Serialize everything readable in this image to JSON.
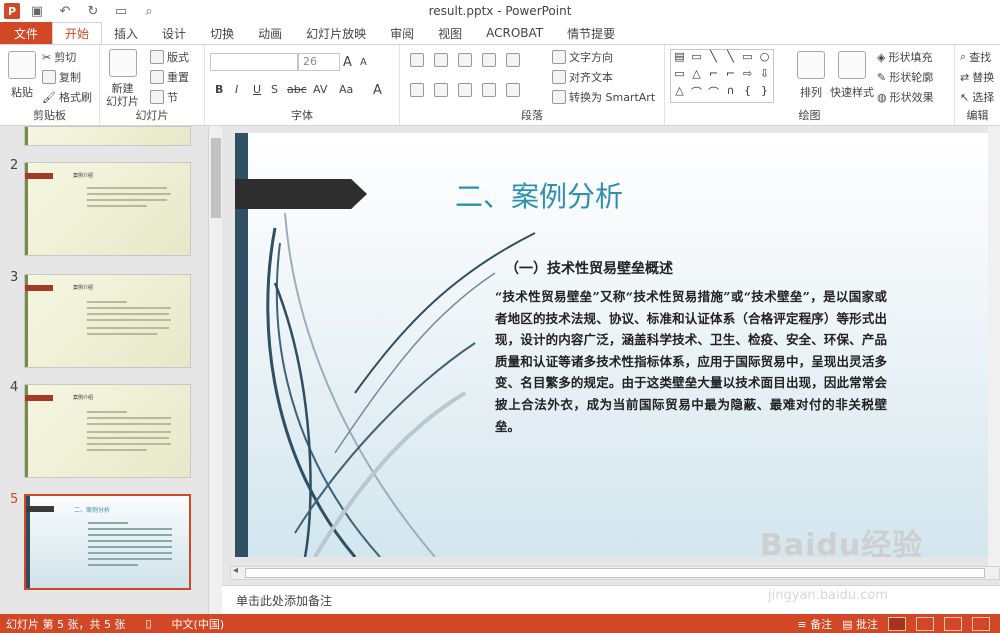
{
  "window": {
    "title": "result.pptx - PowerPoint",
    "app_icon": "P"
  },
  "tabs": [
    "文件",
    "开始",
    "插入",
    "设计",
    "切换",
    "动画",
    "幻灯片放映",
    "审阅",
    "视图",
    "ACROBAT",
    "情节提要"
  ],
  "ribbon": {
    "clipboard": {
      "paste": "粘贴",
      "cut": "剪切",
      "copy": "复制",
      "format_painter": "格式刷",
      "label": "剪贴板"
    },
    "slides": {
      "new_slide": "新建\n幻灯片",
      "layout": "版式",
      "reset": "重置",
      "section": "节",
      "label": "幻灯片"
    },
    "font": {
      "size": "26",
      "bold": "B",
      "italic": "I",
      "underline": "U",
      "strike": "S",
      "shadow": "abc",
      "spacing": "AV",
      "case": "Aa",
      "color": "A",
      "grow": "A",
      "shrink": "A",
      "label": "字体"
    },
    "paragraph": {
      "text_direction": "文字方向",
      "align_text": "对齐文本",
      "smartart": "转换为 SmartArt",
      "label": "段落"
    },
    "drawing": {
      "arrange": "排列",
      "quick_styles": "快速样式",
      "shape_fill": "形状填充",
      "shape_outline": "形状轮廓",
      "shape_effects": "形状效果",
      "label": "绘图"
    },
    "editing": {
      "find": "查找",
      "replace": "替换",
      "select": "选择",
      "label": "编辑"
    }
  },
  "thumbnails": [
    {
      "num": "2",
      "title": "案例介绍"
    },
    {
      "num": "3",
      "title": "案例介绍"
    },
    {
      "num": "4",
      "title": "案例介绍"
    },
    {
      "num": "5",
      "title": "二、案例分析",
      "selected": true
    }
  ],
  "slide": {
    "title": "二、案例分析",
    "subtitle": "（一）技术性贸易壁垒概述",
    "body": "“技术性贸易壁垒”又称“技术性贸易措施”或“技术壁垒”，是以国家或者地区的技术法规、协议、标准和认证体系（合格评定程序）等形式出现，设计的内容广泛，涵盖科学技术、卫生、检疫、安全、环保、产品质量和认证等诸多技术性指标体系，应用于国际贸易中，呈现出灵活多变、名目繁多的规定。由于这类壁垒大量以技术面目出现，因此常常会披上合法外衣，成为当前国际贸易中最为隐蔽、最难对付的非关税壁垒。"
  },
  "notes": {
    "placeholder": "单击此处添加备注"
  },
  "status": {
    "slide_info": "幻灯片 第 5 张，共 5 张",
    "language": "中文(中国)",
    "notes_btn": "备注",
    "comments_btn": "批注"
  },
  "watermark": {
    "brand": "Baidu经验",
    "url": "jingyan.baidu.com"
  },
  "colors": {
    "accent": "#d24726",
    "title_blue": "#2e90b0",
    "slide_strip": "#2f4f62"
  }
}
